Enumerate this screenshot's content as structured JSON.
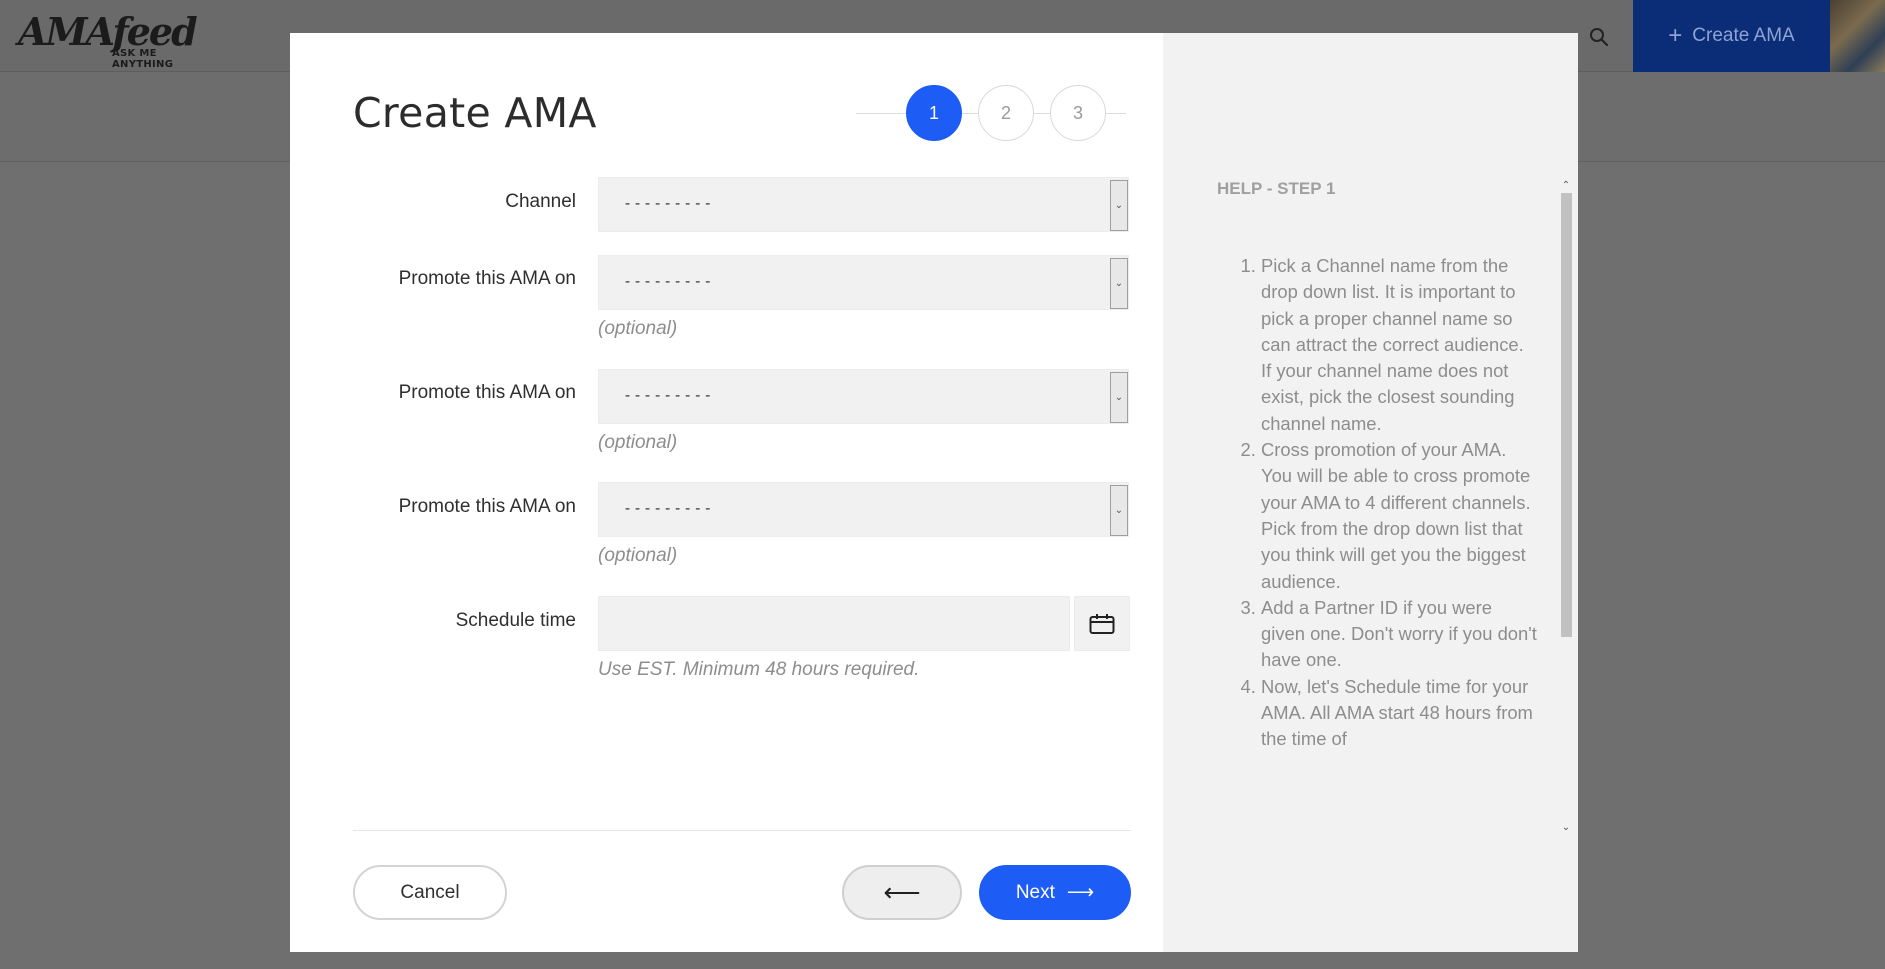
{
  "app": {
    "logo_main": "AMAfeed",
    "logo_sub": "ASK ME ANYTHING",
    "create_button_label": "Create AMA",
    "create_button_icon": "plus-icon",
    "search_icon": "search-icon"
  },
  "modal": {
    "title": "Create AMA",
    "steps": [
      "1",
      "2",
      "3"
    ],
    "active_step": "1",
    "fields": {
      "channel": {
        "label": "Channel",
        "value": "---------"
      },
      "promote_1": {
        "label": "Promote this AMA on",
        "value": "---------",
        "hint": "(optional)"
      },
      "promote_2": {
        "label": "Promote this AMA on",
        "value": "---------",
        "hint": "(optional)"
      },
      "promote_3": {
        "label": "Promote this AMA on",
        "value": "---------",
        "hint": "(optional)"
      },
      "schedule": {
        "label": "Schedule time",
        "value": "",
        "hint": "Use EST. Minimum 48 hours required.",
        "icon": "calendar-icon"
      }
    },
    "buttons": {
      "cancel": "Cancel",
      "back_icon": "arrow-left-icon",
      "back": "⟵",
      "next": "Next",
      "next_arrow": "⟶"
    }
  },
  "help": {
    "title": "HELP - STEP 1",
    "items": [
      "Pick a Channel name from the drop down list. It is important to pick a proper channel name so can attract the correct audience. If your channel name does not exist, pick the closest sounding channel name.",
      "Cross promotion of your AMA. You will be able to cross promote your AMA to 4 different channels. Pick from the drop down list that you think will get you the biggest audience.",
      "Add a Partner ID if you were given one.  Don't worry if you don't have one.",
      "Now, let's Schedule time for your AMA. All AMA start 48 hours from the time of"
    ]
  },
  "colors": {
    "accent": "#1d5cf5",
    "overlay": "#6f6f6f",
    "help_bg": "#f2f2f2",
    "topbar_button": "#0b2d77"
  }
}
